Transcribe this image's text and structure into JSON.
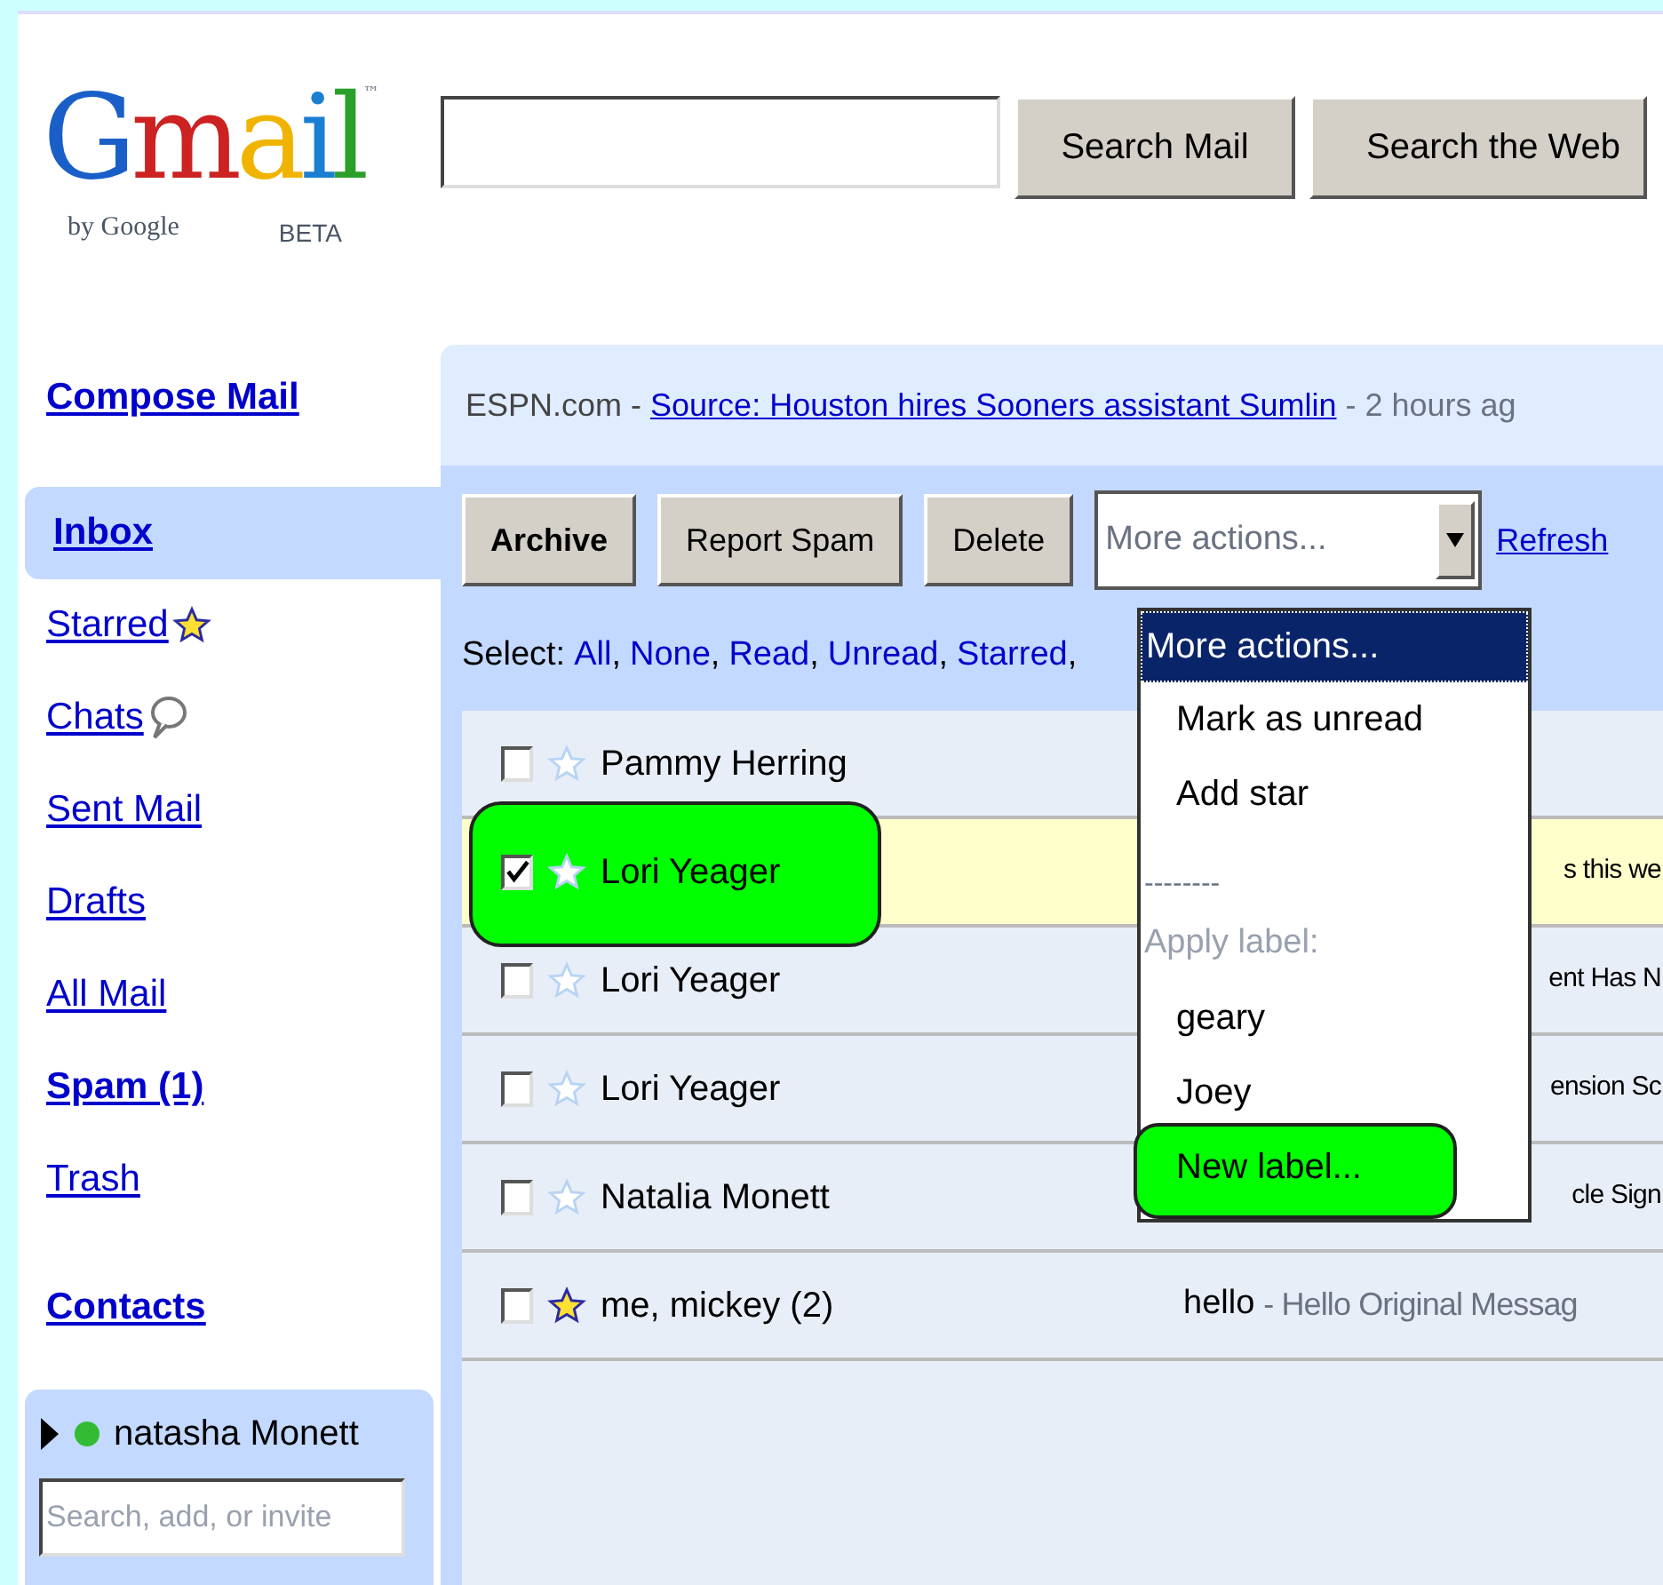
{
  "logo": {
    "word": "Gmail",
    "trademark": "™",
    "byline": "by Google",
    "badge": "BETA"
  },
  "search": {
    "buttons": [
      "Search Mail",
      "Search the Web"
    ]
  },
  "sidebar": {
    "compose": "Compose Mail",
    "items": [
      {
        "label": "Inbox",
        "selected": true,
        "bold": true,
        "kind": "plain"
      },
      {
        "label": "Starred",
        "selected": false,
        "bold": false,
        "kind": "star"
      },
      {
        "label": "Chats",
        "selected": false,
        "bold": false,
        "kind": "chat"
      },
      {
        "label": "Sent Mail",
        "selected": false,
        "bold": false,
        "kind": "plain"
      },
      {
        "label": "Drafts",
        "selected": false,
        "bold": false,
        "kind": "plain"
      },
      {
        "label": "All Mail",
        "selected": false,
        "bold": false,
        "kind": "plain"
      },
      {
        "label": "Spam (1)",
        "selected": false,
        "bold": true,
        "kind": "plain"
      },
      {
        "label": "Trash",
        "selected": false,
        "bold": false,
        "kind": "plain"
      }
    ],
    "contacts": "Contacts",
    "chat": {
      "expanded": false,
      "name": "natasha Monett",
      "placeholder": "Search, add, or invite"
    }
  },
  "news": {
    "source": "ESPN.com -",
    "headline": "Source: Houston hires Sooners assistant Sumlin",
    "time": "- 2 hours ag"
  },
  "toolbar": {
    "buttons": [
      {
        "label": "Archive",
        "bold": true
      },
      {
        "label": "Report Spam",
        "bold": false
      },
      {
        "label": "Delete",
        "bold": false
      }
    ],
    "more_actions": "More actions...",
    "refresh": "Refresh"
  },
  "select": {
    "label": "Select:",
    "separator": ",",
    "links": [
      "All",
      "None",
      "Read",
      "Unread",
      "Starred"
    ]
  },
  "rows": [
    {
      "sender": "Pammy Herring",
      "checked": false,
      "starred": false,
      "selected": false,
      "annotated": false,
      "snippet": ""
    },
    {
      "sender": "Lori Yeager",
      "checked": true,
      "starred": false,
      "selected": true,
      "annotated": true,
      "snippet": "s this we"
    },
    {
      "sender": "Lori Yeager",
      "checked": false,
      "starred": false,
      "selected": false,
      "annotated": false,
      "snippet": "ent Has N"
    },
    {
      "sender": "Lori Yeager",
      "checked": false,
      "starred": false,
      "selected": false,
      "annotated": false,
      "snippet": "ension Sc"
    },
    {
      "sender": "Natalia Monett",
      "checked": false,
      "starred": false,
      "selected": false,
      "annotated": false,
      "snippet": "cle Sign"
    },
    {
      "sender": "me, mickey (2)",
      "checked": false,
      "starred": true,
      "selected": false,
      "annotated": false,
      "subject": "hello",
      "snippet": "- Hello Original Messag"
    }
  ],
  "dropdown": {
    "header": "More actions...",
    "items": [
      {
        "kind": "action",
        "label": "Mark as unread",
        "annotated": false
      },
      {
        "kind": "action",
        "label": "Add star",
        "annotated": false
      },
      {
        "kind": "separator",
        "label": "--------",
        "annotated": false
      },
      {
        "kind": "heading",
        "label": "Apply label:",
        "annotated": false
      },
      {
        "kind": "action",
        "label": "geary",
        "annotated": false
      },
      {
        "kind": "action",
        "label": "Joey",
        "annotated": false
      },
      {
        "kind": "action",
        "label": "New label...",
        "annotated": true
      }
    ]
  }
}
